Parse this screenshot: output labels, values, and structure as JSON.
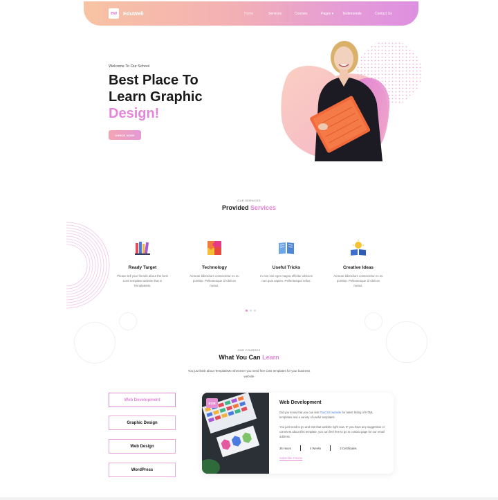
{
  "header": {
    "logo_badge": "ew",
    "logo_text": "EduWell",
    "nav": [
      "Home",
      "Services",
      "Courses",
      "Pages ▾",
      "Testimonials",
      "Contact Us"
    ]
  },
  "hero": {
    "welcome": "Welcome To Our School",
    "title_line1": "Best Place To",
    "title_line2": "Learn Graphic",
    "title_accent": "Design!",
    "button": "CHECK NOW!"
  },
  "services": {
    "tag": "OUR SERVICES",
    "title_plain": "Provided",
    "title_accent": "Services",
    "items": [
      {
        "title": "Ready Target",
        "desc": "Please tell your friends about the best CSS template website that is TemplateMo.",
        "icon": "books-icon"
      },
      {
        "title": "Technology",
        "desc": "Aenean bibendum consectetur ex eu porttitor. Pellentesque id ultrices metus.",
        "icon": "puzzle-icon"
      },
      {
        "title": "Useful Tricks",
        "desc": "In non nisi eget magna efficitur ultricies non quis sapien. Pellentesque tellus.",
        "icon": "open-book-icon"
      },
      {
        "title": "Creative Ideas",
        "desc": "Aenean bibendum consectetur ex eu porttitor. Pellentesque id ultrices metus.",
        "icon": "idea-book-icon"
      }
    ]
  },
  "courses": {
    "tag": "OUR COURSES",
    "title_plain": "What You Can",
    "title_accent": "Learn",
    "subtitle": "You just think about TemplateMo whenever you need free CSS templates for your business website",
    "tabs": [
      "Web Development",
      "Graphic Design",
      "Web Design",
      "WordPress"
    ],
    "card": {
      "price": "$128",
      "title": "Web Development",
      "p1_before": "Did you know that you can visit ",
      "p1_link": "TooCSS website",
      "p1_after": " for latest listing of HTML templates and a variety of useful templates.",
      "p2": "You just need to go and visit that website right now. IF you have any suggestion or comment about this template, you can feel free to go to contact page for our email address.",
      "stat1": "36 Hours",
      "stat2": "4 Weeks",
      "stat3": "3 Certificates",
      "subscribe": "Subscribe Course"
    }
  },
  "colors": {
    "accent": "#e485d8",
    "header_start": "#f8c3a3",
    "header_end": "#de8fe0"
  }
}
